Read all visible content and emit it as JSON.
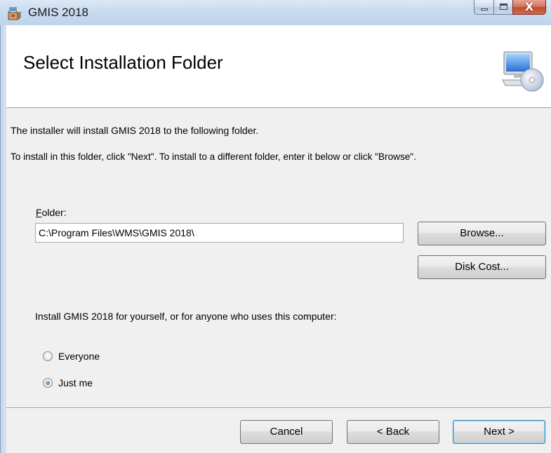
{
  "window": {
    "title": "GMIS 2018",
    "close_glyph": "X",
    "icons": {
      "app": "installer-box-icon",
      "minimize": "minimize-icon",
      "maximize": "maximize-icon",
      "close": "close-icon"
    }
  },
  "banner": {
    "title": "Select Installation Folder",
    "icon": "computer-disc-icon"
  },
  "body": {
    "intro_line1": "The installer will install GMIS 2018 to the following folder.",
    "intro_line2": "To install in this folder, click \"Next\". To install to a different folder, enter it below or click \"Browse\".",
    "folder_label_mnemonic": "F",
    "folder_label_rest": "older:",
    "folder_value": "C:\\Program Files\\WMS\\GMIS 2018\\",
    "browse_label": "Browse...",
    "disk_cost_label": "Disk Cost...",
    "install_for_prompt": "Install GMIS 2018 for yourself, or for anyone who uses this computer:",
    "options": [
      {
        "label": "Everyone",
        "selected": false
      },
      {
        "label": "Just me",
        "selected": true
      }
    ]
  },
  "footer": {
    "cancel_label": "Cancel",
    "back_label": "< Back",
    "next_label": "Next >"
  },
  "colors": {
    "titlebar": "#c9dbef",
    "dialog_bg": "#f0f0f0",
    "banner_bg": "#ffffff",
    "close_button": "#c44a2d",
    "default_button_border": "#3c7fb1"
  }
}
